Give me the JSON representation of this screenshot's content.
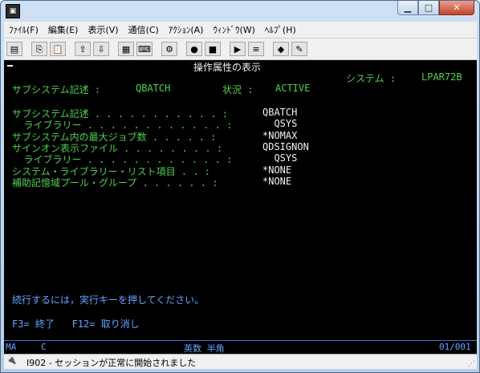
{
  "menu": [
    "ﾌｧｲﾙ(F)",
    "編集(E)",
    "表示(V)",
    "通信(C)",
    "ｱｸｼｮﾝ(A)",
    "ｳｨﾝﾄﾞｳ(W)",
    "ﾍﾙﾌﾟ(H)"
  ],
  "screen": {
    "title": "操作属性の表示",
    "system_label": "システム :",
    "system_value": "LPAR72B",
    "subsystem_label": "サブシステム記述 :",
    "subsystem_value": "QBATCH",
    "status_label": "状況 :",
    "status_value": "ACTIVE",
    "fields": [
      {
        "label": "サブシステム記述 . . . . . . . . . . . :",
        "value": "QBATCH"
      },
      {
        "label": "  ライブラリー . . . . . . . . . . . . :",
        "value": "  QSYS"
      },
      {
        "label": "サブシステム内の最大ジョブ数 . . . . . :",
        "value": "*NOMAX"
      },
      {
        "label": "サインオン表示ファイル . . . . . . . . :",
        "value": "QDSIGNON"
      },
      {
        "label": "  ライブラリー . . . . . . . . . . . . :",
        "value": "  QSYS"
      },
      {
        "label": "システム・ライブラリー・リスト項目 . . :",
        "value": "*NONE"
      },
      {
        "label": "補助記憶域プール・グループ . . . . . . :",
        "value": "*NONE"
      }
    ],
    "instruction": "続行するには，実行キーを押してください。",
    "fkeys": "F3= 終了   F12= 取り消し"
  },
  "oia": {
    "left": "MA",
    "mode": "C",
    "input_mode": "英数 半角",
    "position": "01/001"
  },
  "statusbar": {
    "message": "I902 - セッションが正常に開始されました"
  }
}
